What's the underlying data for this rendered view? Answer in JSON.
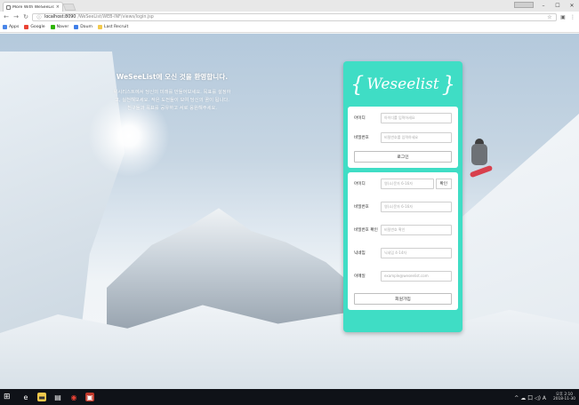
{
  "browser": {
    "tab_title": "More With WeSeeList",
    "tab_close": "×",
    "win_user": "",
    "url_host": "localhost:8090",
    "url_path": "/WeSeeList/WEB-INF/views/login.jsp",
    "star_icon": "☆",
    "bookmarks": [
      {
        "label": "Apps",
        "color": "#4a86e8"
      },
      {
        "label": "Google",
        "color": "#ea4335"
      },
      {
        "label": "Naver",
        "color": "#2db400"
      },
      {
        "label": "Daum",
        "color": "#3f7ee8"
      },
      {
        "label": "Last Recruit",
        "color": "#f2c94c"
      }
    ]
  },
  "welcome": {
    "title": "WeSeeList에 오신 것을 환영합니다.",
    "body": "위시리스트에서 당신의 미래를 만들어보세요. 목표를 설정하고, 실천해보세요. 작은 도전들이 모여 당신의 꿈이 됩니다. 친구들과 목표를 공유하고 서로 응원해주세요."
  },
  "logo": {
    "left": "{",
    "word": "Weseelist",
    "right": "}"
  },
  "login": {
    "id_label": "아이디",
    "id_placeholder": "아이디를 입력하세요",
    "pw_label": "비밀번호",
    "pw_placeholder": "비밀번호를 입력하세요",
    "submit": "로그인"
  },
  "signup": {
    "id_label": "아이디",
    "id_placeholder": "영(소)문자 6-16자",
    "check_button": "확인",
    "pw_label": "비밀번호",
    "pw_placeholder": "영(소)문자 6-16자",
    "pw2_label": "비밀번호 확인",
    "pw2_placeholder": "비밀번호 확인",
    "nick_label": "닉네임",
    "nick_placeholder": "닉네임 4-14자",
    "email_label": "이메일",
    "email_placeholder": "example@weseelist.com",
    "submit": "회원가입"
  },
  "taskbar": {
    "tray": "^ ☁ 口 ◁) A",
    "time": "오후 2:10",
    "date": "2018-11-30"
  }
}
